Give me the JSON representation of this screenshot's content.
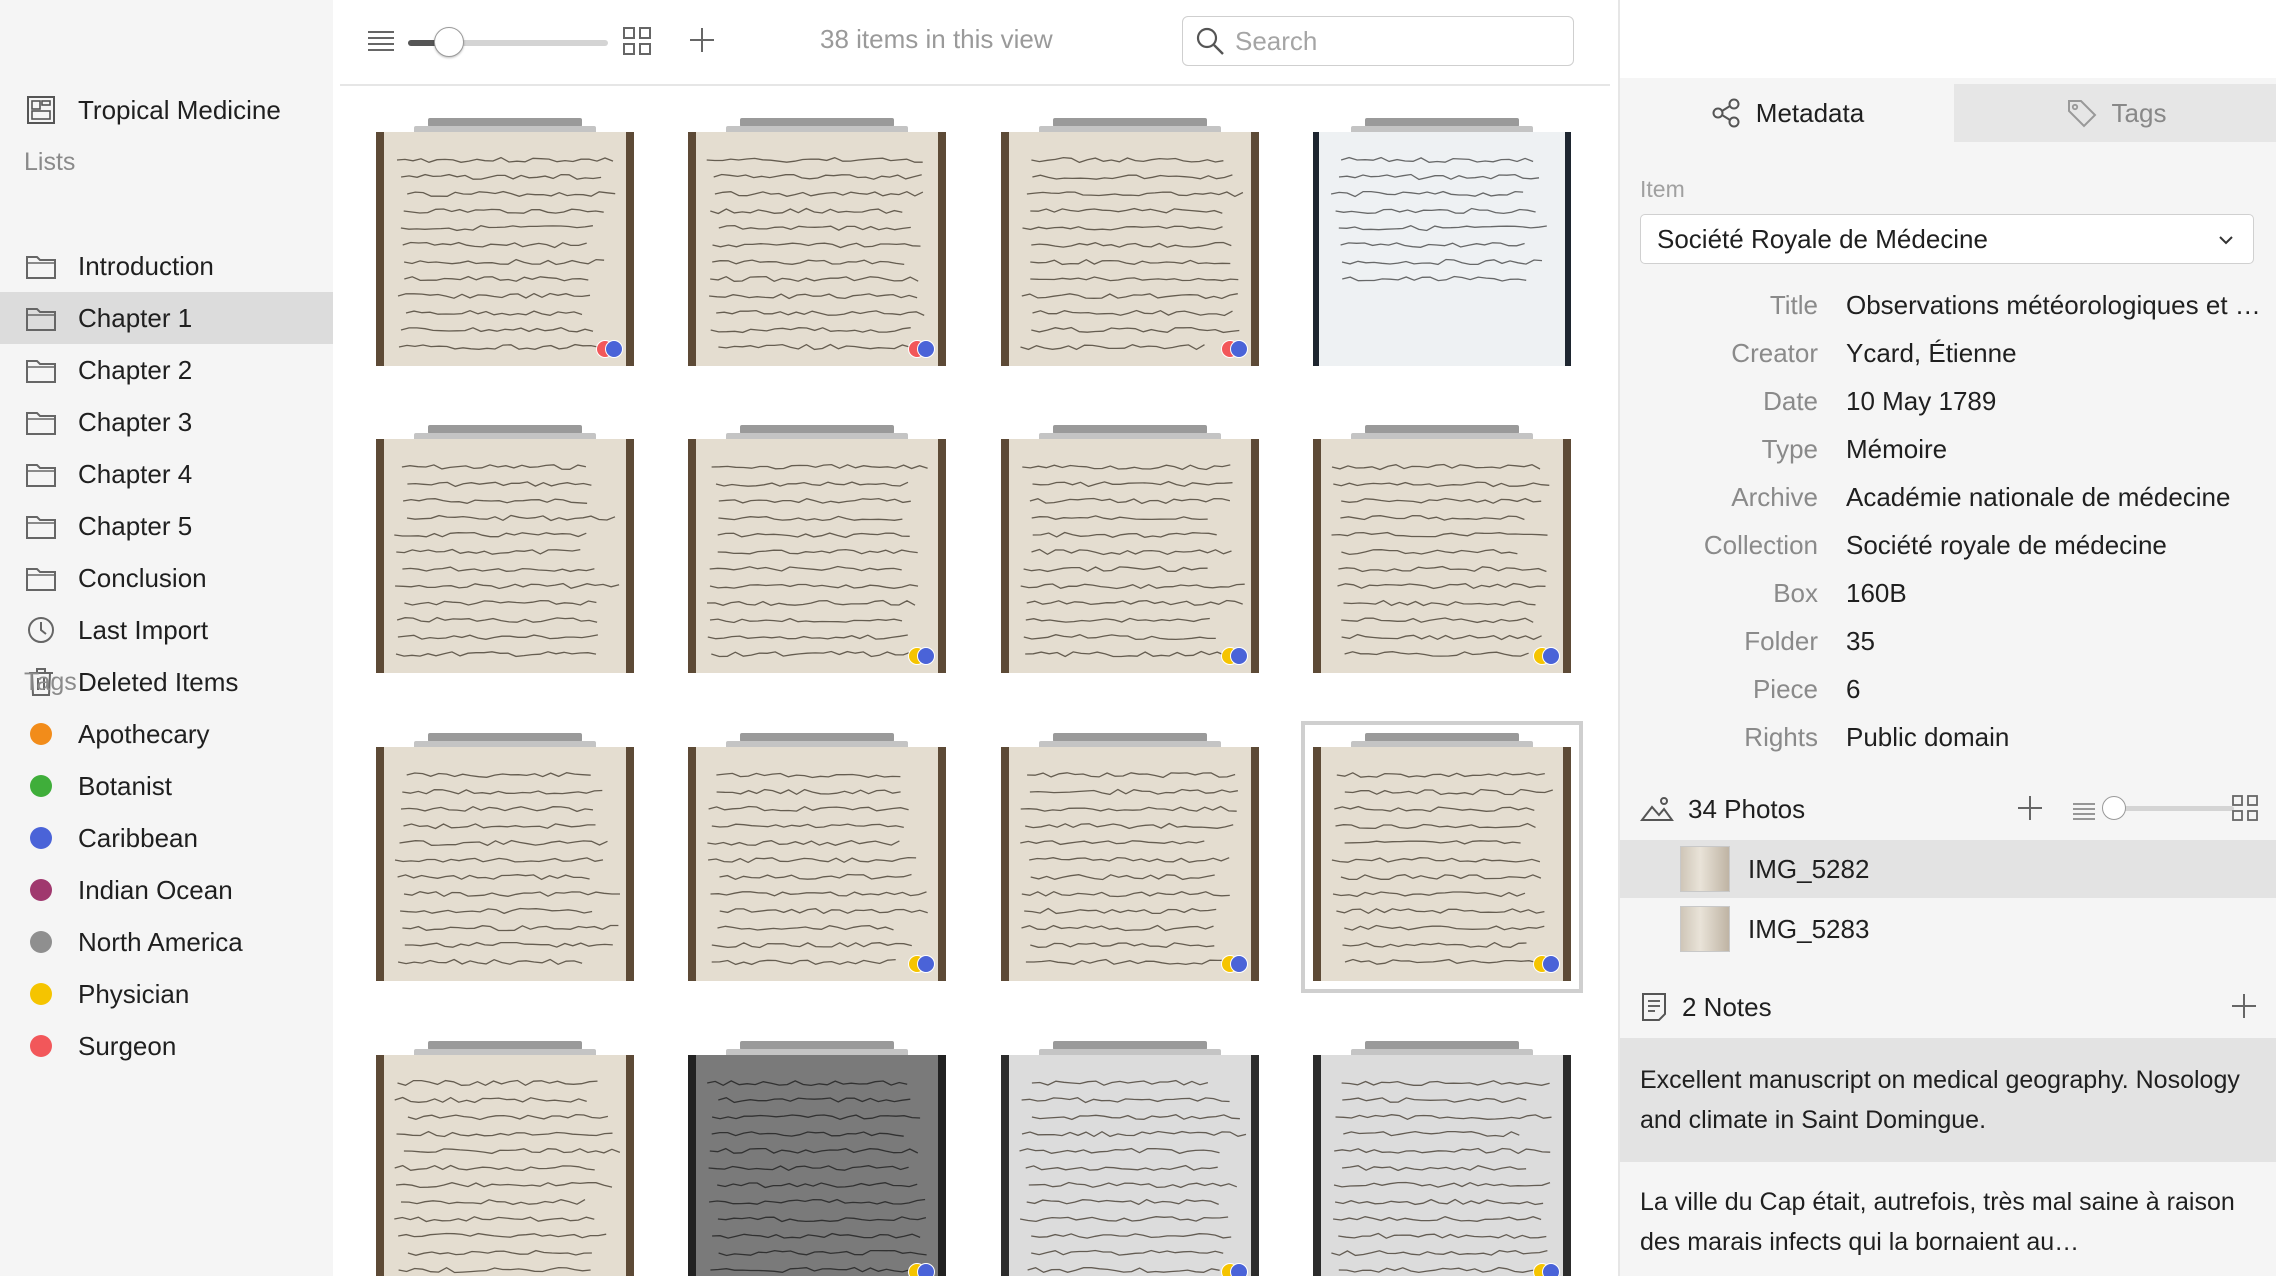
{
  "sidebar": {
    "project": "Tropical Medicine",
    "lists_heading": "Lists",
    "lists": [
      {
        "label": "Introduction",
        "icon": "folder-icon",
        "selected": false
      },
      {
        "label": "Chapter 1",
        "icon": "folder-icon",
        "selected": true
      },
      {
        "label": "Chapter 2",
        "icon": "folder-icon",
        "selected": false
      },
      {
        "label": "Chapter 3",
        "icon": "folder-icon",
        "selected": false
      },
      {
        "label": "Chapter 4",
        "icon": "folder-icon",
        "selected": false
      },
      {
        "label": "Chapter 5",
        "icon": "folder-icon",
        "selected": false
      },
      {
        "label": "Conclusion",
        "icon": "folder-icon",
        "selected": false
      },
      {
        "label": "Last Import",
        "icon": "clock-icon",
        "selected": false
      },
      {
        "label": "Deleted Items",
        "icon": "trash-icon",
        "selected": false
      }
    ],
    "tags_heading": "Tags",
    "tags": [
      {
        "label": "Apothecary",
        "color": "#f28c1a"
      },
      {
        "label": "Botanist",
        "color": "#3fae3a"
      },
      {
        "label": "Caribbean",
        "color": "#4a63d8"
      },
      {
        "label": "Indian Ocean",
        "color": "#a0386e"
      },
      {
        "label": "North America",
        "color": "#8f8f8f"
      },
      {
        "label": "Physician",
        "color": "#f5c400"
      },
      {
        "label": "Surgeon",
        "color": "#f2575a"
      }
    ]
  },
  "toolbar": {
    "count_text": "38 items in this view",
    "search_placeholder": "Search",
    "zoom_level": 0.2,
    "list_view_icon": "list-view-icon",
    "grid_view_icon": "grid-view-icon",
    "add_icon": "plus-icon"
  },
  "grid": {
    "items": [
      {
        "style": "aged",
        "dots": [
          "#f2575a",
          "#4a63d8"
        ],
        "selected": false
      },
      {
        "style": "aged",
        "dots": [
          "#f2575a",
          "#4a63d8"
        ],
        "selected": false
      },
      {
        "style": "aged",
        "dots": [
          "#f2575a",
          "#4a63d8"
        ],
        "selected": false
      },
      {
        "style": "typed",
        "dots": [],
        "selected": false
      },
      {
        "style": "aged",
        "dots": [],
        "selected": false
      },
      {
        "style": "aged",
        "dots": [
          "#f5c400",
          "#4a63d8"
        ],
        "selected": false
      },
      {
        "style": "aged",
        "dots": [
          "#f5c400",
          "#4a63d8"
        ],
        "selected": false
      },
      {
        "style": "aged",
        "dots": [
          "#f5c400",
          "#4a63d8"
        ],
        "selected": false
      },
      {
        "style": "aged",
        "dots": [],
        "selected": false
      },
      {
        "style": "aged",
        "dots": [
          "#f5c400",
          "#4a63d8"
        ],
        "selected": false
      },
      {
        "style": "aged",
        "dots": [
          "#f5c400",
          "#4a63d8"
        ],
        "selected": false
      },
      {
        "style": "aged",
        "dots": [
          "#f5c400",
          "#4a63d8"
        ],
        "selected": true
      },
      {
        "style": "aged",
        "dots": [],
        "selected": false
      },
      {
        "style": "dark",
        "dots": [
          "#f5c400",
          "#4a63d8"
        ],
        "selected": false
      },
      {
        "style": "gray",
        "dots": [
          "#f5c400",
          "#4a63d8"
        ],
        "selected": false
      },
      {
        "style": "gray",
        "dots": [
          "#f5c400",
          "#4a63d8"
        ],
        "selected": false
      }
    ]
  },
  "inspector": {
    "tabs": [
      {
        "label": "Metadata",
        "icon": "share-nodes-icon",
        "active": true
      },
      {
        "label": "Tags",
        "icon": "tag-icon",
        "active": false
      }
    ],
    "item_label": "Item",
    "item_value": "Société Royale de Médecine",
    "fields": [
      {
        "key": "Title",
        "value": "Observations météorologiques et médicales"
      },
      {
        "key": "Creator",
        "value": "Ycard, Étienne"
      },
      {
        "key": "Date",
        "value": "10 May 1789"
      },
      {
        "key": "Type",
        "value": "Mémoire"
      },
      {
        "key": "Archive",
        "value": "Académie nationale de médecine"
      },
      {
        "key": "Collection",
        "value": "Société royale de médecine"
      },
      {
        "key": "Box",
        "value": "160B"
      },
      {
        "key": "Folder",
        "value": "35"
      },
      {
        "key": "Piece",
        "value": "6"
      },
      {
        "key": "Rights",
        "value": "Public domain"
      }
    ],
    "photos": {
      "heading": "34 Photos",
      "zoom_level": 0.05,
      "items": [
        {
          "label": "IMG_5282",
          "selected": true
        },
        {
          "label": "IMG_5283",
          "selected": false
        }
      ]
    },
    "notes": {
      "heading": "2 Notes",
      "items": [
        {
          "text": "Excellent manuscript on medical geography. Nosology and climate in Saint Domingue.",
          "selected": true
        },
        {
          "text": "La ville du Cap était, autrefois, très mal saine à raison des marais infects qui la bornaient au…",
          "selected": false
        }
      ]
    }
  }
}
